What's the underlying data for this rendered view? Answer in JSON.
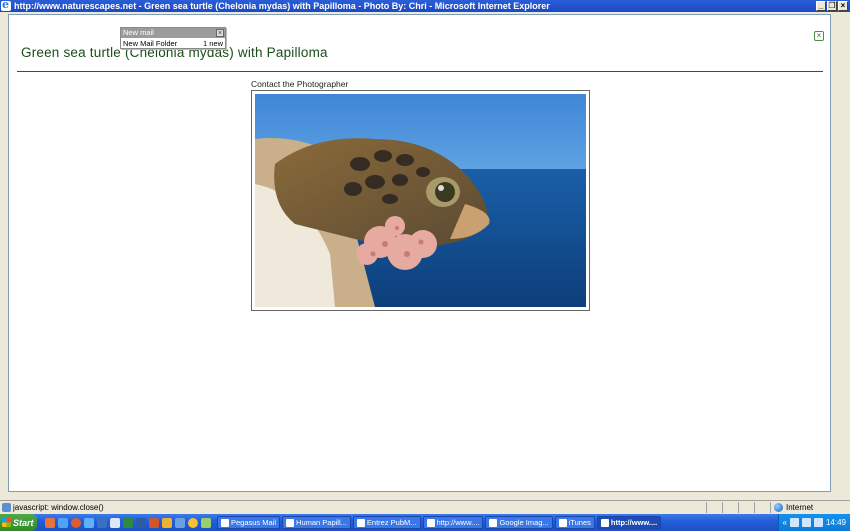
{
  "window": {
    "title": "http://www.naturescapes.net - Green sea turtle (Chelonia mydas) with Papilloma - Photo By: Chri - Microsoft Internet Explorer",
    "minimize_glyph": "_",
    "maximize_glyph": "❐",
    "close_glyph": "×"
  },
  "page": {
    "title": "Green sea turtle (Chelonia mydas) with Papilloma",
    "contact_link": "Contact the Photographer",
    "close_glyph": "×"
  },
  "popup": {
    "title": "New mail",
    "close_glyph": "×",
    "folder": "New Mail Folder",
    "count": "1 new"
  },
  "status": {
    "text": "javascript: window.close()",
    "zone": "Internet"
  },
  "taskbar": {
    "start_label": "Start",
    "tasks": [
      {
        "label": "Pegasus Mail"
      },
      {
        "label": "Human Papill..."
      },
      {
        "label": "Entrez PubM..."
      },
      {
        "label": "http://www...."
      },
      {
        "label": "Google Imag..."
      },
      {
        "label": "iTunes"
      },
      {
        "label": "http://www...."
      }
    ],
    "tray_chevron": "«",
    "clock": "14:49"
  },
  "colors": {
    "title_green": "#1a4d1a",
    "rule_green": "#2d5a2d",
    "xp_blue": "#245edb",
    "start_green": "#2f8a2a"
  }
}
